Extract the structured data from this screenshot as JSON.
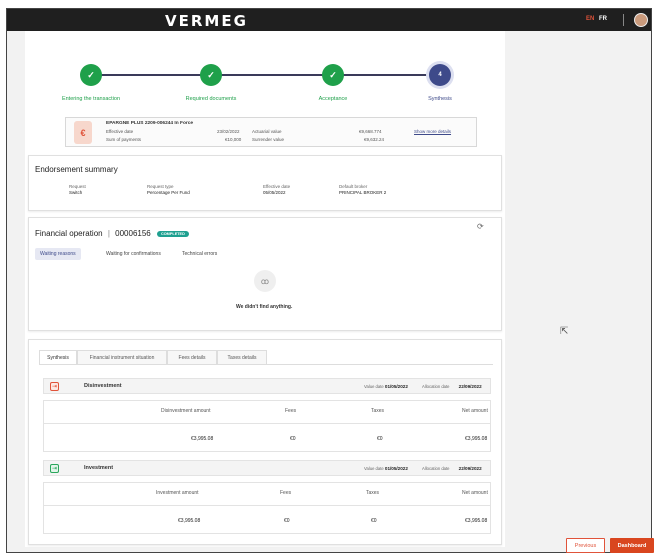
{
  "header": {
    "brand": "VERMEG",
    "lang_en": "EN",
    "lang_fr": "FR"
  },
  "stepper": {
    "steps": [
      {
        "label": "Entering the transaction",
        "state": "done",
        "marker": "✓"
      },
      {
        "label": "Required documents",
        "state": "done",
        "marker": "✓"
      },
      {
        "label": "Acceptance",
        "state": "done",
        "marker": "✓"
      },
      {
        "label": "Synthesis",
        "state": "current",
        "marker": "4"
      }
    ]
  },
  "contract": {
    "title": "EPARGNE PLUS 2209-006244 In Force",
    "effective_date_label": "Effective date",
    "effective_date": "23/02/2022",
    "sum_payments_label": "Sum of payments",
    "sum_payments": "€10,000",
    "actuarial_label": "Actuarial value",
    "actuarial_value": "€9,668.774",
    "surrender_label": "Surrender value",
    "surrender_value": "€9,632.24",
    "show_more": "Show more details",
    "icon": "€"
  },
  "endorsement": {
    "title": "Endorsement summary",
    "request_label": "Request",
    "request_value": "Switch",
    "request_type_label": "Request type",
    "request_type_value": "Percentage Per Fund",
    "effective_date_label": "Effective date",
    "effective_date_value": "05/05/2022",
    "broker_label": "Default broker",
    "broker_value": "PRINCIPAL BROKER 2"
  },
  "financial_operation": {
    "title": "Financial operation",
    "separator": "|",
    "number": "00006156",
    "status": "COMPLETED",
    "refresh_icon": "⟳",
    "subtabs": [
      "Waiting reasons",
      "Waiting for confirmations",
      "Technical errors"
    ],
    "empty_icon": "ꝏ",
    "empty_text": "We didn't find anything."
  },
  "synthesis": {
    "tabs": [
      "Synthesis",
      "Financial instrument situation",
      "Fees details",
      "Taxes details"
    ],
    "operations": [
      {
        "name": "Disinvestment",
        "icon": "⇥",
        "value_date_label": "Value date",
        "value_date": "01/05/2022",
        "allocation_date_label": "Allocation date",
        "allocation_date": "22/09/2022",
        "headers": [
          "Disinvestment amount",
          "Fees",
          "Taxes",
          "Net amount"
        ],
        "values": [
          "€3,995.08",
          "€0",
          "€0",
          "€3,995.08"
        ]
      },
      {
        "name": "Investment",
        "icon": "⇥",
        "value_date_label": "Value date",
        "value_date": "01/05/2022",
        "allocation_date_label": "Allocation date",
        "allocation_date": "22/09/2022",
        "headers": [
          "Investment amount",
          "Fees",
          "Taxes",
          "Net amount"
        ],
        "values": [
          "€3,995.08",
          "€0",
          "€0",
          "€3,995.08"
        ]
      }
    ]
  },
  "footer": {
    "previous": "Previous",
    "dashboard": "Dashboard"
  },
  "colors": {
    "accent": "#d9461f",
    "success": "#1fa04a",
    "primary": "#3e4a8a",
    "badge": "#1fa090"
  }
}
